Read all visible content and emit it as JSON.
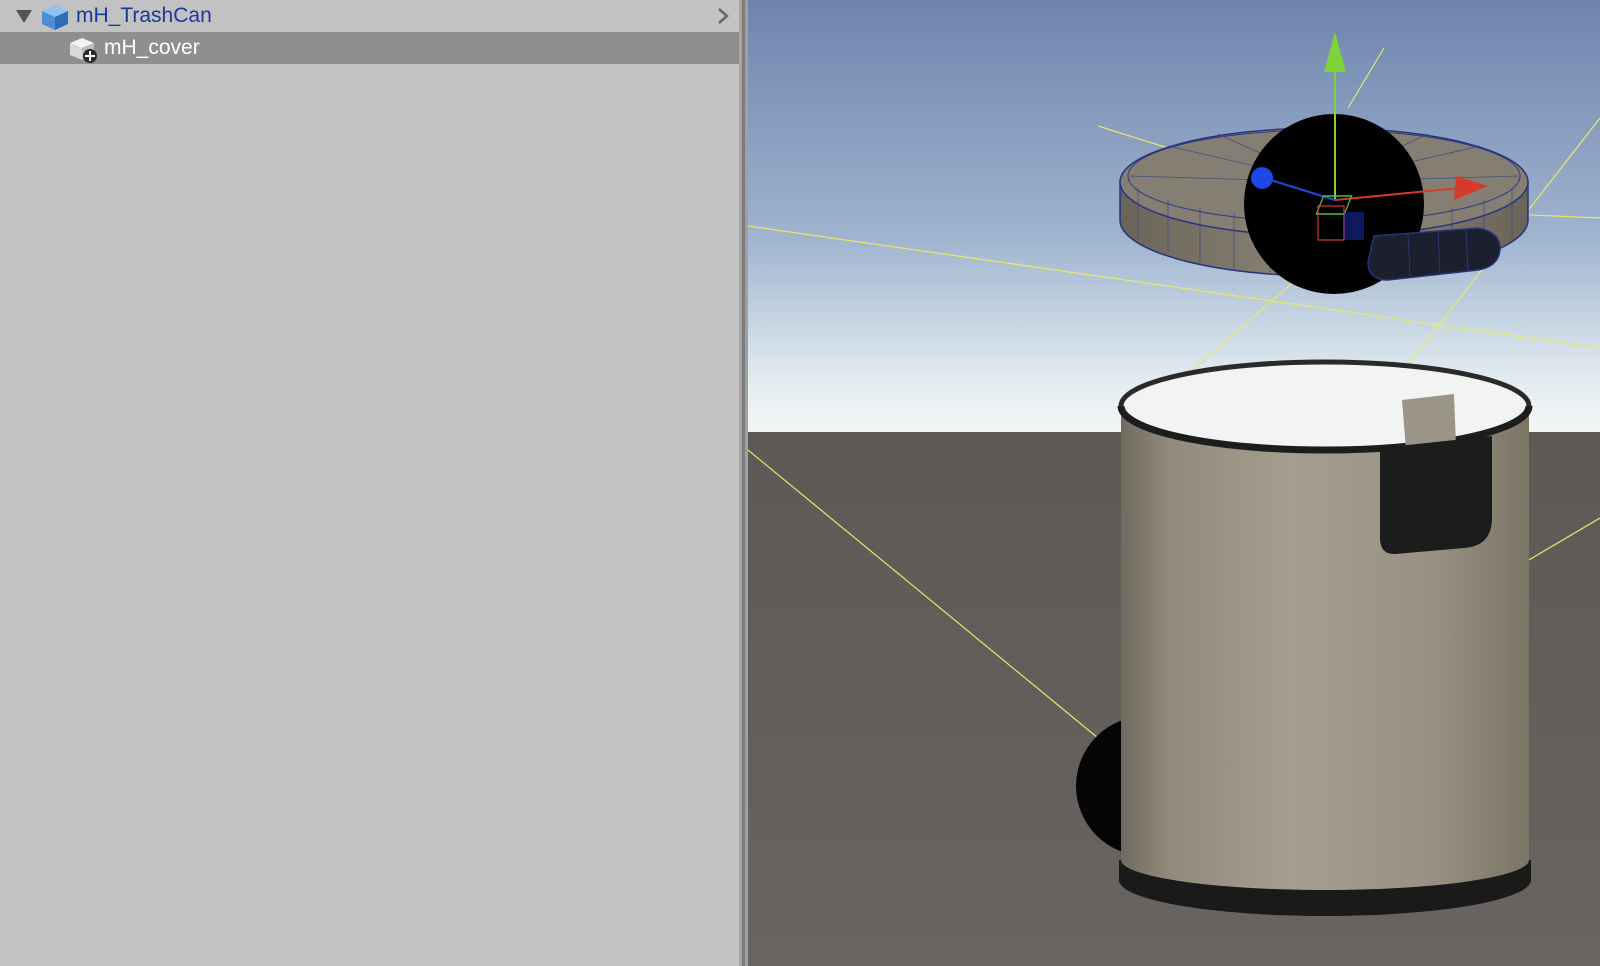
{
  "hierarchy": {
    "items": [
      {
        "label": "mH_TrashCan",
        "icon": "prefab-cube-icon",
        "expanded": true,
        "selected": false
      },
      {
        "label": "mH_cover",
        "icon": "mesh-object-icon",
        "selected": true
      }
    ]
  },
  "scene_view": {
    "gizmo_axes": [
      "x",
      "y",
      "z"
    ],
    "colors": {
      "x_axis": "#d83a2a",
      "y_axis": "#7fd23a",
      "z_axis": "#1f47e6",
      "bounds_lines": "#e8e86a"
    }
  }
}
